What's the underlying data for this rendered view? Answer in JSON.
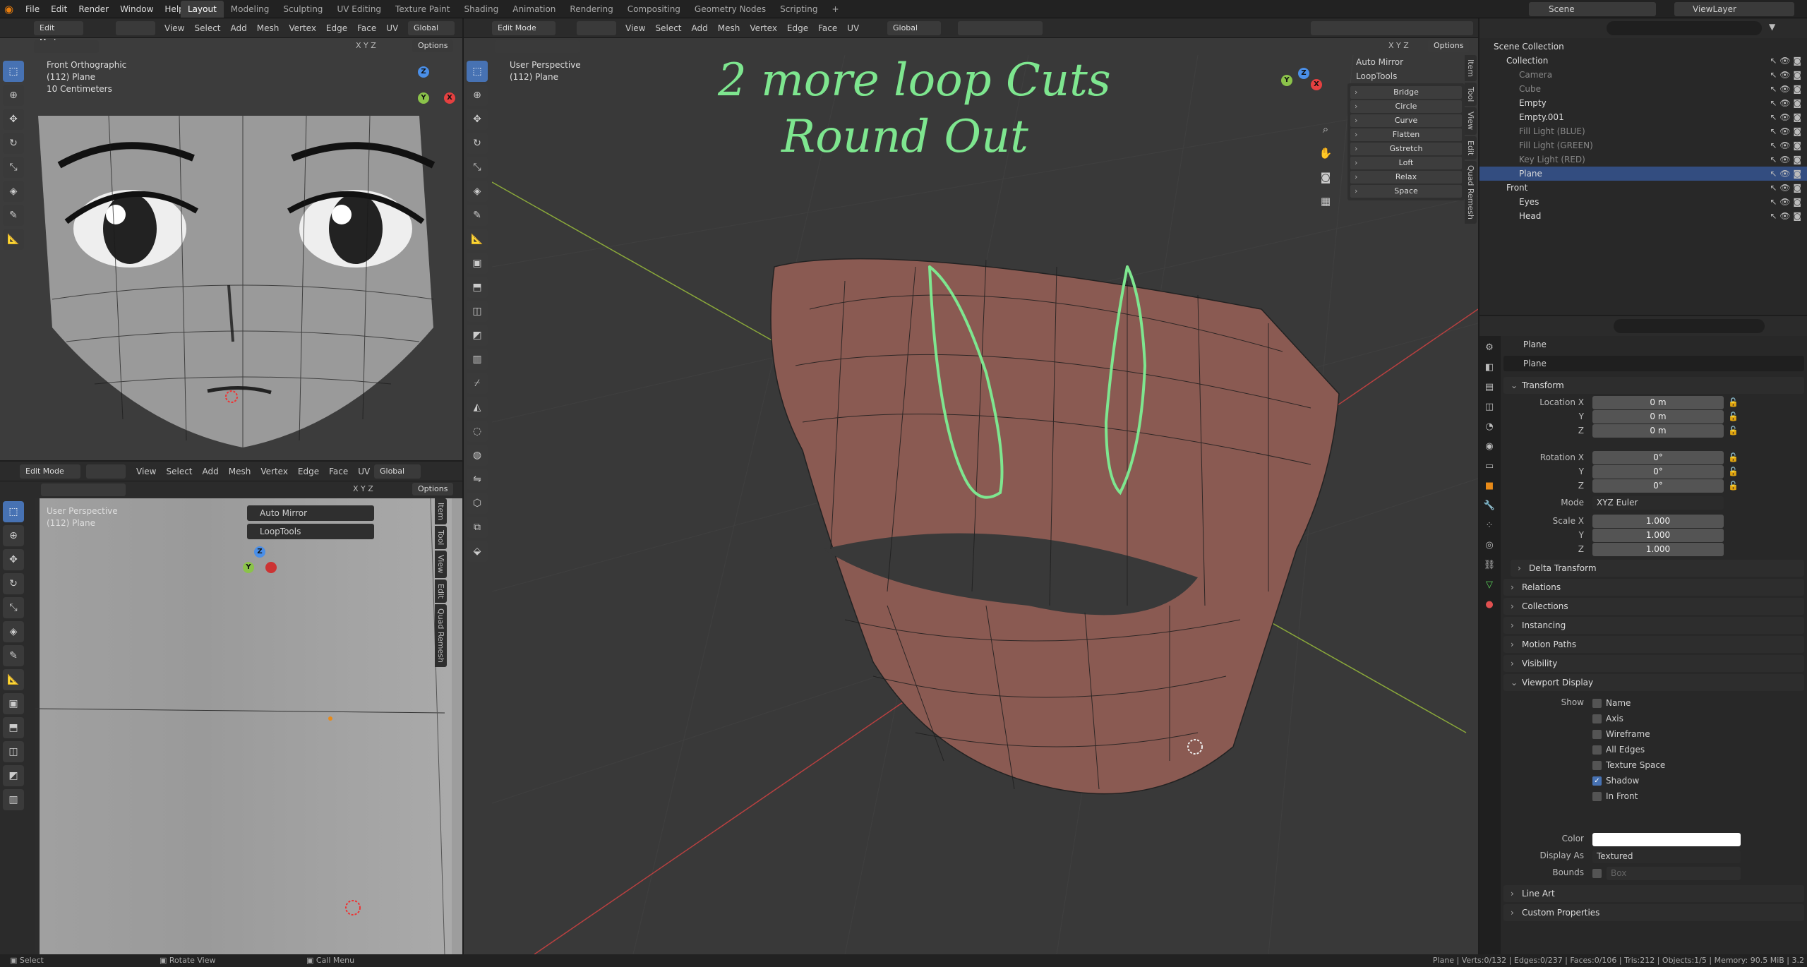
{
  "topbar": {
    "menus": [
      "File",
      "Edit",
      "Render",
      "Window",
      "Help"
    ],
    "workspaces": [
      "Layout",
      "Modeling",
      "Sculpting",
      "UV Editing",
      "Texture Paint",
      "Shading",
      "Animation",
      "Rendering",
      "Compositing",
      "Geometry Nodes",
      "Scripting"
    ],
    "active_workspace": "Layout",
    "scene_label": "Scene",
    "viewlayer_label": "ViewLayer"
  },
  "viewport_tl": {
    "mode": "Edit Mode",
    "menus": [
      "View",
      "Select",
      "Add",
      "Mesh",
      "Vertex",
      "Edge",
      "Face",
      "UV"
    ],
    "orientation": "Global",
    "options": "Options",
    "axes": [
      "X",
      "Y",
      "Z"
    ],
    "info": [
      "Front Orthographic",
      "(112) Plane",
      "10 Centimeters"
    ]
  },
  "viewport_bl": {
    "mode": "Edit Mode",
    "menus": [
      "View",
      "Select",
      "Add",
      "Mesh",
      "Vertex",
      "Edge",
      "Face",
      "UV"
    ],
    "orientation": "Global",
    "options": "Options",
    "axes": [
      "X",
      "Y",
      "Z"
    ],
    "info": [
      "User Perspective",
      "(112) Plane"
    ],
    "npanel": [
      "Auto Mirror",
      "LoopTools"
    ],
    "tabs": [
      "Item",
      "Tool",
      "View",
      "Edit",
      "Quad Remesh"
    ]
  },
  "viewport_main": {
    "mode": "Edit Mode",
    "menus": [
      "View",
      "Select",
      "Add",
      "Mesh",
      "Vertex",
      "Edge",
      "Face",
      "UV"
    ],
    "orientation": "Global",
    "options": "Options",
    "axes": [
      "X",
      "Y",
      "Z"
    ],
    "info": [
      "User Perspective",
      "(112) Plane"
    ],
    "npanel_header": [
      "Auto Mirror",
      "LoopTools"
    ],
    "looptools": [
      "Bridge",
      "Circle",
      "Curve",
      "Flatten",
      "Gstretch",
      "Loft",
      "Relax",
      "Space"
    ],
    "tabs": [
      "Item",
      "Tool",
      "View",
      "Edit",
      "Quad Remesh"
    ],
    "annotation_line1": "2 more loop Cuts",
    "annotation_line2": "Round Out",
    "annotation_color": "#7ee68f"
  },
  "outliner": {
    "root": "Scene Collection",
    "rows": [
      {
        "label": "Collection",
        "depth": 1,
        "dim": false
      },
      {
        "label": "Camera",
        "depth": 2,
        "dim": true
      },
      {
        "label": "Cube",
        "depth": 2,
        "dim": true
      },
      {
        "label": "Empty",
        "depth": 2,
        "dim": false
      },
      {
        "label": "Empty.001",
        "depth": 2,
        "dim": false
      },
      {
        "label": "Fill Light (BLUE)",
        "depth": 2,
        "dim": true
      },
      {
        "label": "Fill Light (GREEN)",
        "depth": 2,
        "dim": true
      },
      {
        "label": "Key Light (RED)",
        "depth": 2,
        "dim": true
      },
      {
        "label": "Plane",
        "depth": 2,
        "dim": false,
        "selected": true
      },
      {
        "label": "Front",
        "depth": 1,
        "dim": false
      },
      {
        "label": "Eyes",
        "depth": 2,
        "dim": false
      },
      {
        "label": "Head",
        "depth": 2,
        "dim": false
      }
    ]
  },
  "properties": {
    "object_name": "Plane",
    "object_field": "Plane",
    "transform_label": "Transform",
    "location": {
      "label": "Location X",
      "y": "Y",
      "z": "Z",
      "values": [
        "0 m",
        "0 m",
        "0 m"
      ]
    },
    "rotation": {
      "label": "Rotation X",
      "y": "Y",
      "z": "Z",
      "values": [
        "0°",
        "0°",
        "0°"
      ]
    },
    "mode_label": "Mode",
    "mode_value": "XYZ Euler",
    "scale": {
      "label": "Scale X",
      "y": "Y",
      "z": "Z",
      "values": [
        "1.000",
        "1.000",
        "1.000"
      ]
    },
    "delta": "Delta Transform",
    "sections": [
      "Relations",
      "Collections",
      "Instancing",
      "Motion Paths",
      "Visibility"
    ],
    "viewport_display": "Viewport Display",
    "show_label": "Show",
    "show_items": [
      {
        "label": "Name",
        "checked": false
      },
      {
        "label": "Axis",
        "checked": false
      },
      {
        "label": "Wireframe",
        "checked": false
      },
      {
        "label": "All Edges",
        "checked": false
      },
      {
        "label": "Texture Space",
        "checked": false
      },
      {
        "label": "Shadow",
        "checked": true
      },
      {
        "label": "In Front",
        "checked": false
      }
    ],
    "color_label": "Color",
    "display_as_label": "Display As",
    "display_as_value": "Textured",
    "bounds_label": "Bounds",
    "bounds_value": "Box",
    "bottom_sections": [
      "Line Art",
      "Custom Properties"
    ]
  },
  "statusbar": {
    "select": "Select",
    "rotate": "Rotate View",
    "menu": "Call Menu",
    "stats": "Plane | Verts:0/132 | Edges:0/237 | Faces:0/106 | Tris:212 | Objects:1/5 | Memory: 90.5 MiB | 3.2"
  }
}
